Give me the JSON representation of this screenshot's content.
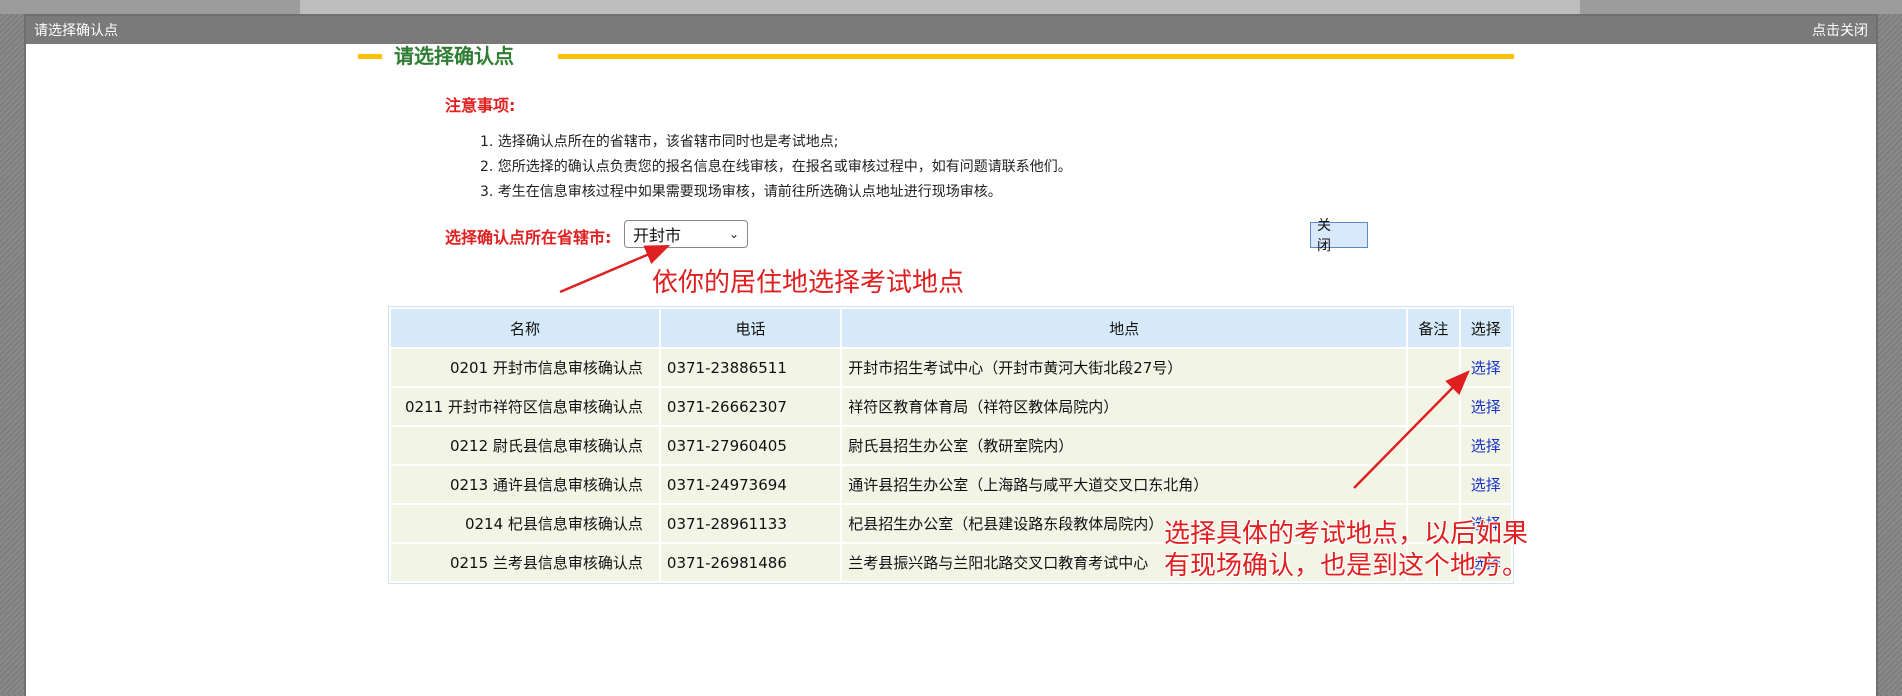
{
  "dialog": {
    "title": "请选择确认点",
    "close_label": "点击关闭"
  },
  "section": {
    "title": "请选择确认点"
  },
  "notes": {
    "title": "注意事项:",
    "items": [
      "1. 选择确认点所在的省辖市，该省辖市同时也是考试地点;",
      "2. 您所选择的确认点负责您的报名信息在线审核，在报名或审核过程中，如有问题请联系他们。",
      "3. 考生在信息审核过程中如果需要现场审核，请前往所选确认点地址进行现场审核。"
    ]
  },
  "province": {
    "label": "选择确认点所在省辖市:",
    "selected": "开封市"
  },
  "close_button": "关 闭",
  "annotations": {
    "select_city": "依你的居住地选择考试地点",
    "select_site_line1": "选择具体的考试地点，以后如果",
    "select_site_line2": "有现场确认，也是到这个地方。"
  },
  "table": {
    "headers": [
      "名称",
      "电话",
      "地点",
      "备注",
      "选择"
    ],
    "rows": [
      {
        "name": "0201 开封市信息审核确认点",
        "phone": "0371-23886511",
        "address": "开封市招生考试中心（开封市黄河大街北段27号）",
        "note": "",
        "action": "选择"
      },
      {
        "name": "0211 开封市祥符区信息审核确认点",
        "phone": "0371-26662307",
        "address": "祥符区教育体育局（祥符区教体局院内）",
        "note": "",
        "action": "选择"
      },
      {
        "name": "0212 尉氏县信息审核确认点",
        "phone": "0371-27960405",
        "address": "尉氏县招生办公室（教研室院内）",
        "note": "",
        "action": "选择"
      },
      {
        "name": "0213 通许县信息审核确认点",
        "phone": "0371-24973694",
        "address": "通许县招生办公室（上海路与咸平大道交叉口东北角）",
        "note": "",
        "action": "选择"
      },
      {
        "name": "0214 杞县信息审核确认点",
        "phone": "0371-28961133",
        "address": "杞县招生办公室（杞县建设路东段教体局院内）",
        "note": "",
        "action": "选择"
      },
      {
        "name": "0215 兰考县信息审核确认点",
        "phone": "0371-26981486",
        "address": "兰考县振兴路与兰阳北路交叉口教育考试中心",
        "note": "",
        "action": "选择"
      }
    ]
  },
  "colors": {
    "accent_yellow": "#ffc000",
    "title_green": "#2e7d32",
    "warning_red": "#e02020",
    "link_blue": "#1a33c8",
    "header_blue": "#d6e9f8",
    "row_bg": "#f2f5e6"
  }
}
